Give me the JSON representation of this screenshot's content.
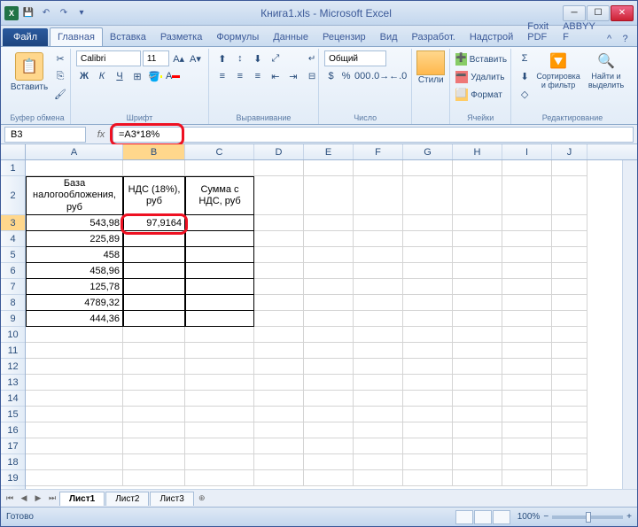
{
  "window": {
    "title": "Книга1.xls - Microsoft Excel"
  },
  "tabs": {
    "file": "Файл",
    "items": [
      "Главная",
      "Вставка",
      "Разметка",
      "Формулы",
      "Данные",
      "Рецензир",
      "Вид",
      "Разработ.",
      "Надстрой",
      "Foxit PDF",
      "ABBYY F"
    ],
    "active_index": 0
  },
  "ribbon": {
    "clipboard": {
      "paste": "Вставить",
      "label": "Буфер обмена"
    },
    "font": {
      "name": "Calibri",
      "size": "11",
      "label": "Шрифт"
    },
    "alignment": {
      "label": "Выравнивание"
    },
    "number": {
      "format": "Общий",
      "label": "Число"
    },
    "styles": {
      "btn": "Стили",
      "label": ""
    },
    "cells": {
      "insert": "Вставить",
      "delete": "Удалить",
      "format": "Формат",
      "label": "Ячейки"
    },
    "editing": {
      "sort": "Сортировка и фильтр",
      "find": "Найти и выделить",
      "label": "Редактирование"
    }
  },
  "formula_bar": {
    "name_box": "B3",
    "formula": "=A3*18%"
  },
  "columns": [
    "A",
    "B",
    "C",
    "D",
    "E",
    "F",
    "G",
    "H",
    "I",
    "J"
  ],
  "headers": {
    "A": "База налогообложения, руб",
    "B": "НДС (18%), руб",
    "C": "Сумма с НДС, руб"
  },
  "data_rows": [
    {
      "r": 3,
      "A": "543,98",
      "B": "97,9164",
      "C": ""
    },
    {
      "r": 4,
      "A": "225,89",
      "B": "",
      "C": ""
    },
    {
      "r": 5,
      "A": "458",
      "B": "",
      "C": ""
    },
    {
      "r": 6,
      "A": "458,96",
      "B": "",
      "C": ""
    },
    {
      "r": 7,
      "A": "125,78",
      "B": "",
      "C": ""
    },
    {
      "r": 8,
      "A": "4789,32",
      "B": "",
      "C": ""
    },
    {
      "r": 9,
      "A": "444,36",
      "B": "",
      "C": ""
    }
  ],
  "selected_cell": "B3",
  "sheets": {
    "items": [
      "Лист1",
      "Лист2",
      "Лист3"
    ],
    "active": 0
  },
  "status": {
    "ready": "Готово",
    "zoom": "100%"
  }
}
